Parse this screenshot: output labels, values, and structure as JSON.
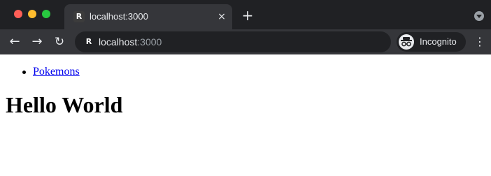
{
  "browser": {
    "tab": {
      "favicon": "R",
      "title": "localhost:3000",
      "close_icon": "×"
    },
    "new_tab_icon": "+",
    "address_bar": {
      "favicon": "R",
      "host": "localhost",
      "port": ":3000"
    },
    "nav": {
      "back_icon": "←",
      "forward_icon": "→",
      "reload_icon": "↻"
    },
    "profile_label": "Incognito",
    "menu_icon": "⋮",
    "colors": {
      "frame": "#202124",
      "toolbar": "#35363a",
      "close": "#ff5f57",
      "minimize": "#febc2e",
      "maximize": "#28c840"
    }
  },
  "page": {
    "nav_links": [
      {
        "label": "Pokemons"
      }
    ],
    "heading": "Hello World",
    "link_color": "#0000ee"
  }
}
